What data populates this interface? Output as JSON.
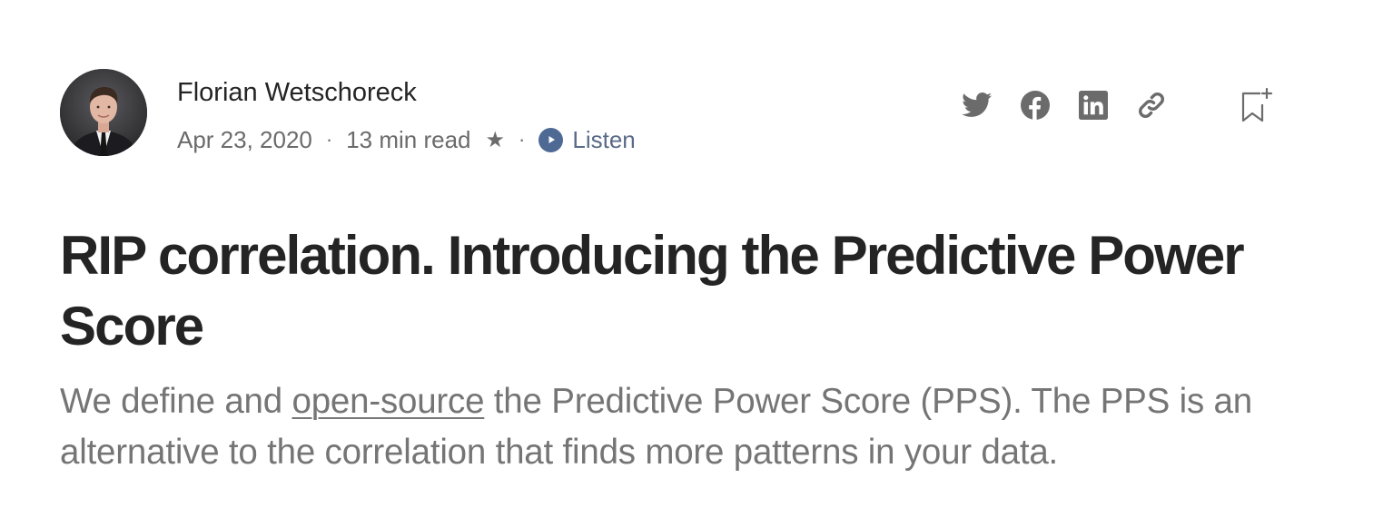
{
  "author": {
    "name": "Florian Wetschoreck",
    "avatar_alt": "avatar"
  },
  "meta": {
    "date": "Apr 23, 2020",
    "separator": "·",
    "read_time": "13 min read",
    "member_star": "★",
    "listen_label": "Listen"
  },
  "share": {
    "icons": [
      "twitter-icon",
      "facebook-icon",
      "linkedin-icon",
      "link-icon",
      "bookmark-icon"
    ]
  },
  "article": {
    "title": "RIP correlation. Introducing the Predictive Power Score",
    "subtitle_before": "We define and ",
    "subtitle_link": "open-source",
    "subtitle_after": " the Predictive Power Score (PPS). The PPS is an alternative to the correlation that finds more patterns in your data."
  },
  "colors": {
    "text": "#242424",
    "meta": "#6b6b6b",
    "subtitle": "#757575",
    "icon": "#6b6b6b",
    "listen_accent": "#4e6a94"
  }
}
